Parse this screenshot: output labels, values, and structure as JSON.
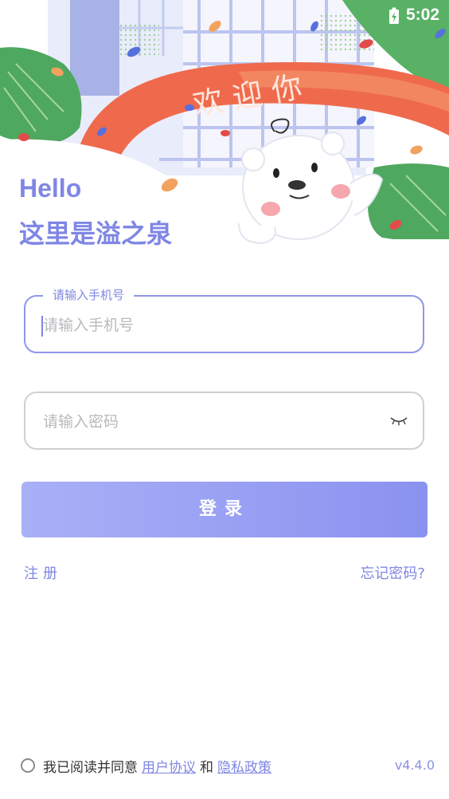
{
  "status_bar": {
    "time": "5:02"
  },
  "hero": {
    "banner_text": "欢 迎 你"
  },
  "greeting": {
    "hello": "Hello",
    "subtitle": "这里是溢之泉"
  },
  "phone_field": {
    "legend": "请输入手机号",
    "placeholder": "请输入手机号",
    "value": ""
  },
  "password_field": {
    "placeholder": "请输入密码",
    "value": ""
  },
  "login_button": {
    "label": "登录"
  },
  "links": {
    "register": "注册",
    "forgot": "忘记密码?"
  },
  "agreement": {
    "prefix": "我已阅读并同意",
    "user_agreement": "用户协议",
    "and": "和",
    "privacy_policy": "隐私政策",
    "checked": false
  },
  "version": "v4.4.0",
  "colors": {
    "accent": "#7f86e4",
    "button_start": "#aab0f6",
    "button_end": "#8a92f0"
  }
}
